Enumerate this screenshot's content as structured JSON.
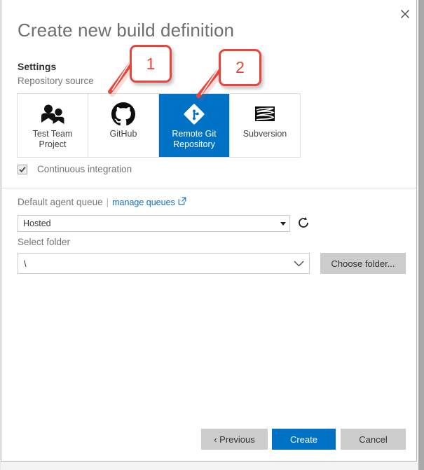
{
  "dialog": {
    "title": "Create new build definition",
    "close_label": "close-icon"
  },
  "settings": {
    "heading": "Settings",
    "repository_source_label": "Repository source",
    "tiles": [
      {
        "label": "Test Team Project",
        "icon": "team-project-icon",
        "selected": false
      },
      {
        "label": "GitHub",
        "icon": "github-icon",
        "selected": false
      },
      {
        "label": "Remote Git Repository",
        "icon": "git-icon",
        "selected": true
      },
      {
        "label": "Subversion",
        "icon": "subversion-icon",
        "selected": false
      }
    ],
    "continuous_integration": {
      "label": "Continuous integration",
      "checked": true,
      "disabled": true
    }
  },
  "agent_queue": {
    "label": "Default agent queue",
    "separator": "|",
    "manage_link": "manage queues",
    "external_icon": "external-link-icon",
    "selected_value": "Hosted",
    "options": [
      "Hosted"
    ],
    "refresh_icon": "refresh-icon"
  },
  "folder": {
    "label": "Select folder",
    "value": "\\",
    "placeholder": "\\",
    "chevron_icon": "chevron-down-icon",
    "choose_button": "Choose folder..."
  },
  "footer": {
    "previous": "‹ Previous",
    "create": "Create",
    "cancel": "Cancel"
  },
  "annotations": [
    {
      "number": "1",
      "target": "github-tile"
    },
    {
      "number": "2",
      "target": "remote-git-repository-tile"
    }
  ],
  "colors": {
    "accent_blue": "#0072c6",
    "annotation_red": "#e8453c",
    "button_grey": "#cccccc",
    "border_grey": "#dededd",
    "muted_text": "#767676"
  }
}
